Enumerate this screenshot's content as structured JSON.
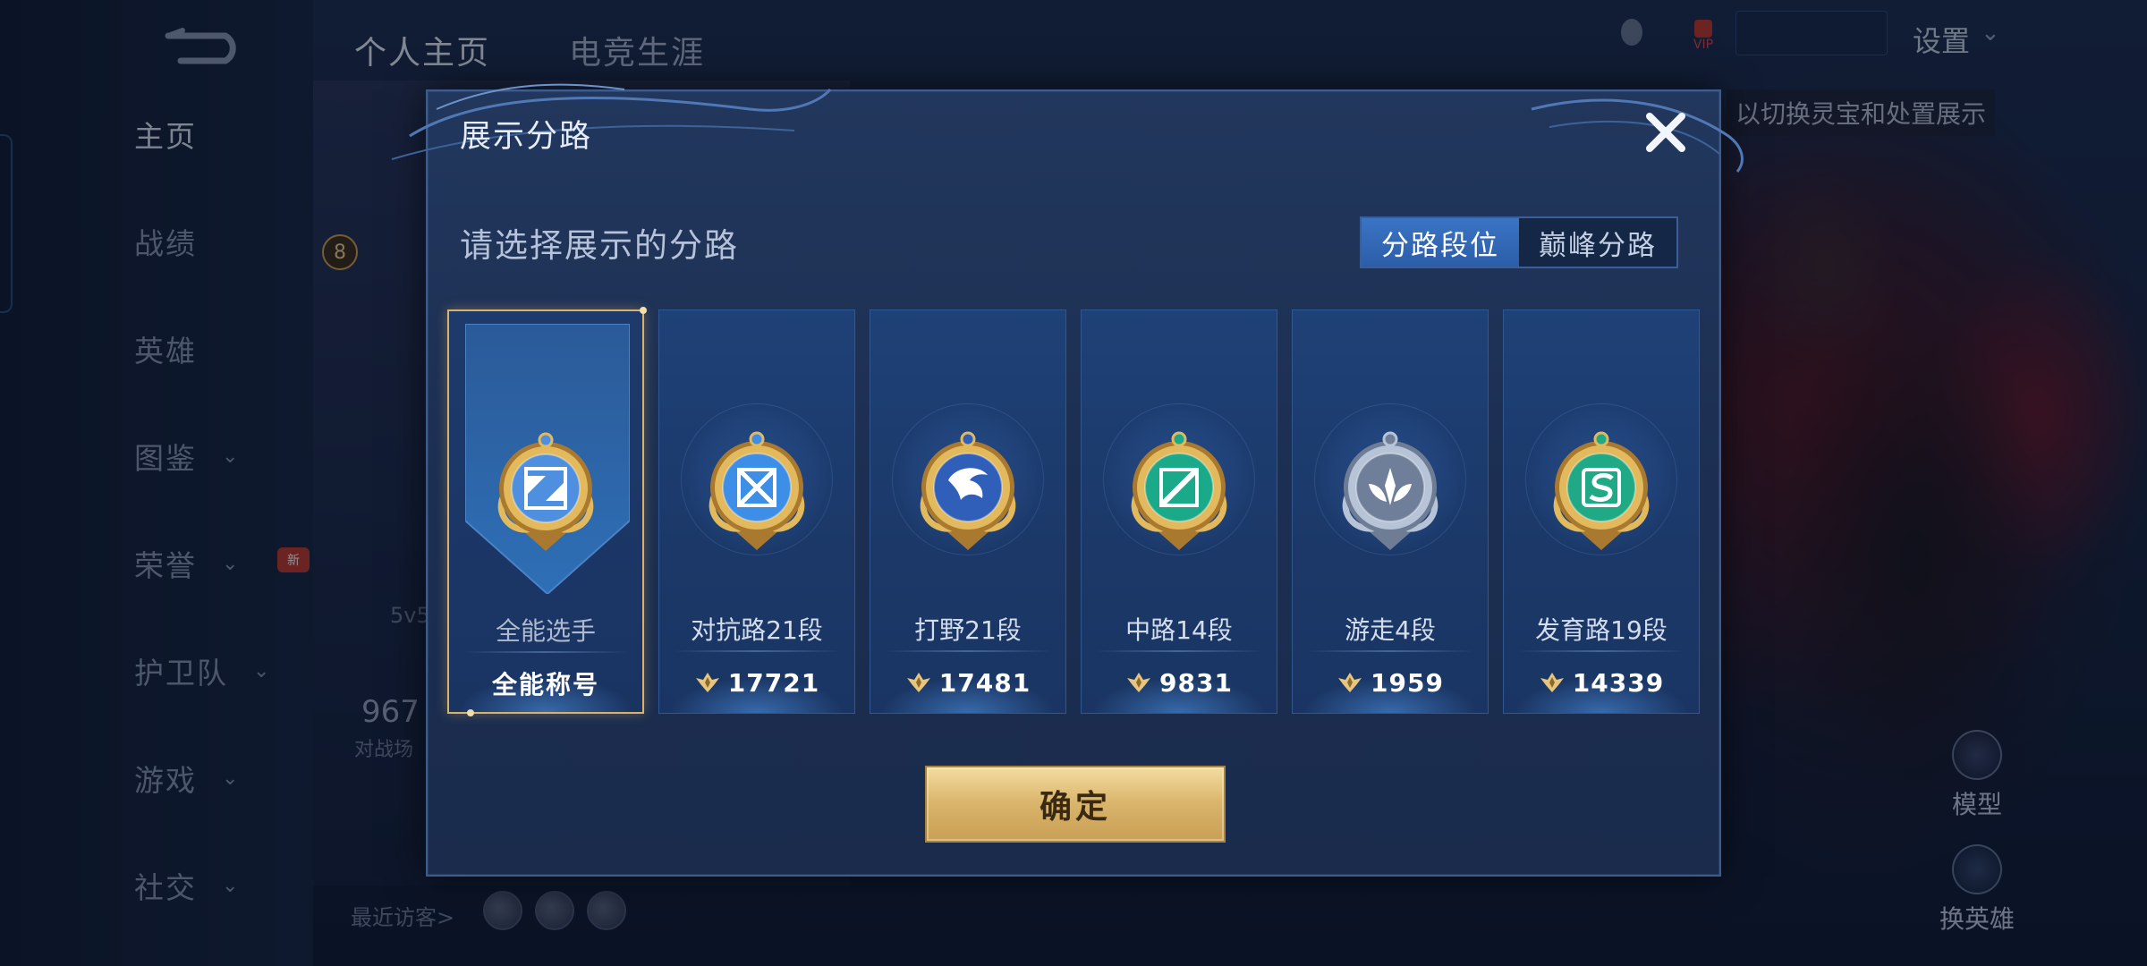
{
  "sidebar": {
    "items": [
      {
        "label": "主页",
        "active": true,
        "chevron": false
      },
      {
        "label": "战绩",
        "active": false,
        "chevron": false
      },
      {
        "label": "英雄",
        "active": false,
        "chevron": false
      },
      {
        "label": "图鉴",
        "active": false,
        "chevron": true
      },
      {
        "label": "荣誉",
        "active": false,
        "chevron": true
      },
      {
        "label": "护卫队",
        "active": false,
        "chevron": true
      },
      {
        "label": "游戏",
        "active": false,
        "chevron": true
      },
      {
        "label": "社交",
        "active": false,
        "chevron": true
      }
    ],
    "new_badge": "新"
  },
  "top_tabs": [
    {
      "label": "个人主页",
      "active": true
    },
    {
      "label": "电竞生涯",
      "active": false
    }
  ],
  "profile": {
    "level": "8",
    "mode_text": "5v5",
    "count_text": "967",
    "count_label": "对战场",
    "visitors_label": "最近访客>"
  },
  "header_right": {
    "vip_label": "VIP",
    "settings_label": "设置",
    "tip": "以切换灵宝和处置展示"
  },
  "right_actions": {
    "model_label": "模型",
    "change_hero_label": "换英雄"
  },
  "dialog": {
    "title": "展示分路",
    "subtitle": "请选择展示的分路",
    "toggle": [
      {
        "label": "分路段位",
        "active": true
      },
      {
        "label": "巅峰分路",
        "active": false
      }
    ],
    "confirm_label": "确定",
    "close_icon": "close-x-icon",
    "cards": [
      {
        "rank": "全能选手",
        "value": "全能称号",
        "selected": true,
        "emblem": "all-round-emblem-icon",
        "gem": "#4f8fe0"
      },
      {
        "rank": "对抗路21段",
        "value": "17721",
        "selected": false,
        "emblem": "clash-lane-emblem-icon",
        "gem": "#3d8ee6"
      },
      {
        "rank": "打野21段",
        "value": "17481",
        "selected": false,
        "emblem": "jungle-emblem-icon",
        "gem": "#2f5fb8"
      },
      {
        "rank": "中路14段",
        "value": "9831",
        "selected": false,
        "emblem": "mid-lane-emblem-icon",
        "gem": "#1aa989"
      },
      {
        "rank": "游走4段",
        "value": "1959",
        "selected": false,
        "emblem": "roam-emblem-icon",
        "gem": "#6f7f99"
      },
      {
        "rank": "发育路19段",
        "value": "14339",
        "selected": false,
        "emblem": "farm-lane-emblem-icon",
        "gem": "#1fa985"
      }
    ]
  },
  "colors": {
    "accent_gold": "#d8b26a",
    "toggle_active": "#3a74c4",
    "card_bg": "#1e4177"
  }
}
